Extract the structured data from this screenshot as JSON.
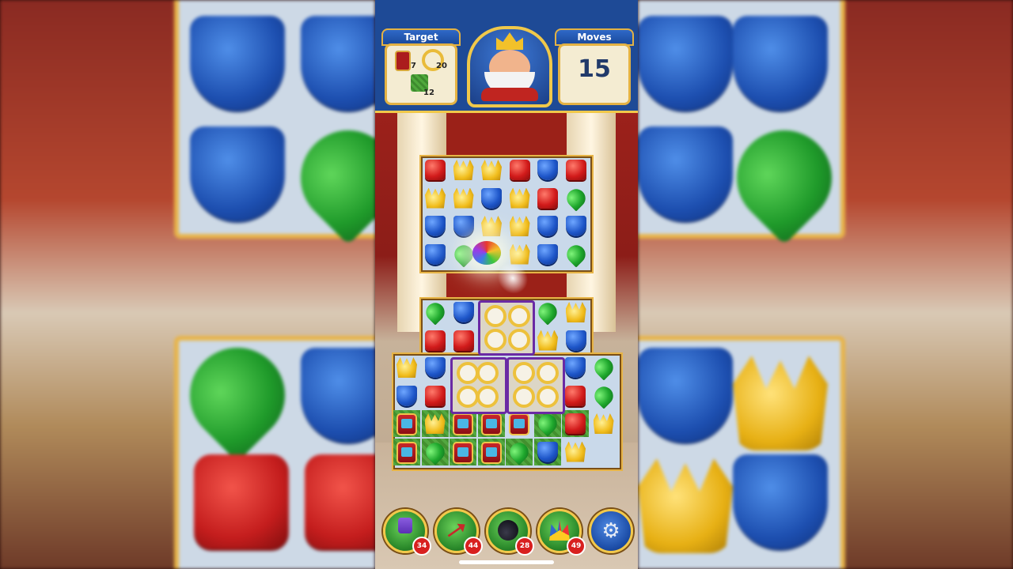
{
  "hud": {
    "target_label": "Target",
    "moves_label": "Moves",
    "moves_value": "15",
    "targets": [
      {
        "icon": "lantern-icon",
        "count": "7"
      },
      {
        "icon": "ring-icon",
        "count": "20"
      },
      {
        "icon": "grass-icon",
        "count": "12"
      }
    ]
  },
  "boosters": [
    {
      "icon": "hammer-icon",
      "count": "34"
    },
    {
      "icon": "arrow-icon",
      "count": "44"
    },
    {
      "icon": "cannon-icon",
      "count": "28"
    },
    {
      "icon": "jester-hat-icon",
      "count": "49"
    }
  ],
  "settings_icon": "gear-icon",
  "colors": {
    "hud_blue": "#1e4a96",
    "gold_border": "#e7b446"
  }
}
